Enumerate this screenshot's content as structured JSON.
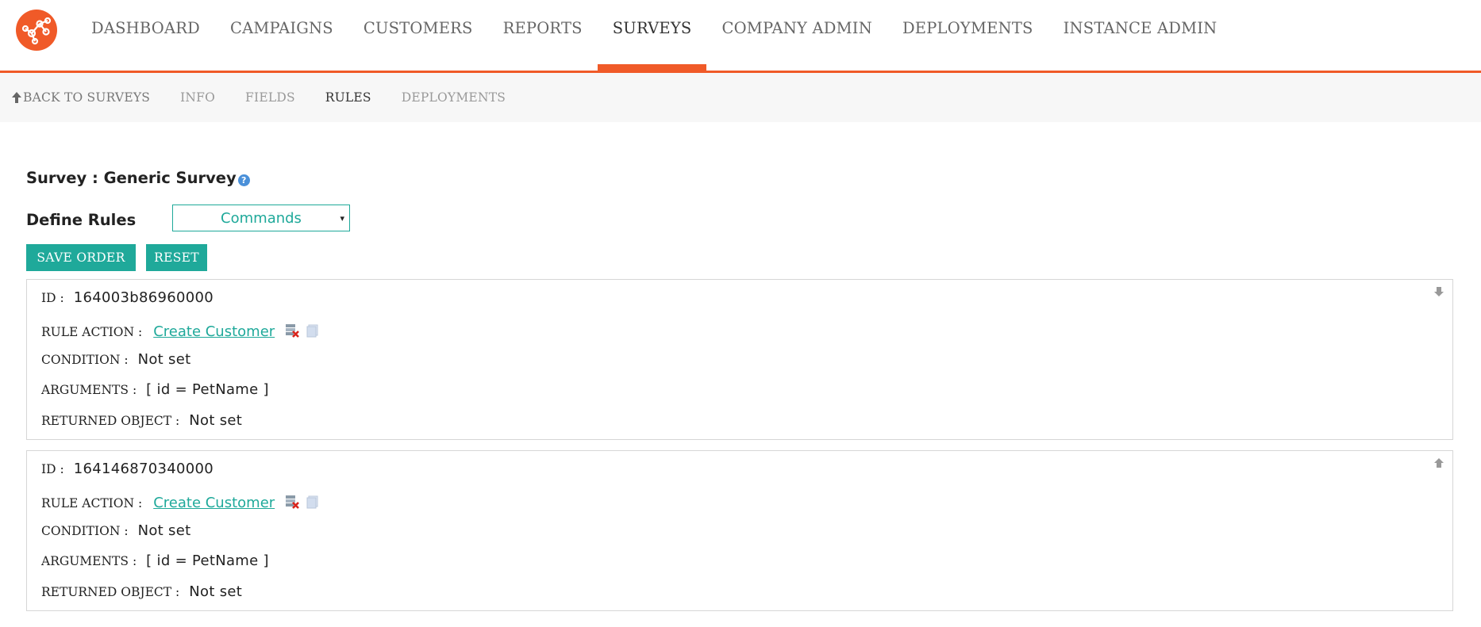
{
  "nav": {
    "items": [
      {
        "label": "DASHBOARD"
      },
      {
        "label": "CAMPAIGNS"
      },
      {
        "label": "CUSTOMERS"
      },
      {
        "label": "REPORTS"
      },
      {
        "label": "SURVEYS",
        "active": true
      },
      {
        "label": "COMPANY ADMIN"
      },
      {
        "label": "DEPLOYMENTS"
      },
      {
        "label": "INSTANCE ADMIN"
      }
    ]
  },
  "subnav": {
    "back": "BACK TO SURVEYS",
    "items": [
      "INFO",
      "FIELDS",
      "RULES",
      "DEPLOYMENTS"
    ],
    "active": "RULES"
  },
  "survey": {
    "title": "Survey : Generic Survey",
    "help": "?"
  },
  "rules_define": {
    "label": "Define Rules",
    "selected": "Commands",
    "caret": "▾"
  },
  "buttons": {
    "save_order": "SAVE ORDER",
    "reset": "RESET"
  },
  "labels": {
    "id": "ID :",
    "rule_action": "RULE ACTION :",
    "condition": "CONDITION :",
    "arguments": "ARGUMENTS :",
    "returned_object": "RETURNED OBJECT :"
  },
  "rules": [
    {
      "id": "164003b86960000",
      "action": "Create Customer",
      "condition": "Not set",
      "arguments": "[ id = PetName ]",
      "returned_object": "Not set"
    },
    {
      "id": "164146870340000",
      "action": "Create Customer",
      "condition": "Not set",
      "arguments": "[ id = PetName ]",
      "returned_object": "Not set"
    }
  ],
  "colors": {
    "accent": "#f05a28",
    "teal": "#1fa99a"
  }
}
